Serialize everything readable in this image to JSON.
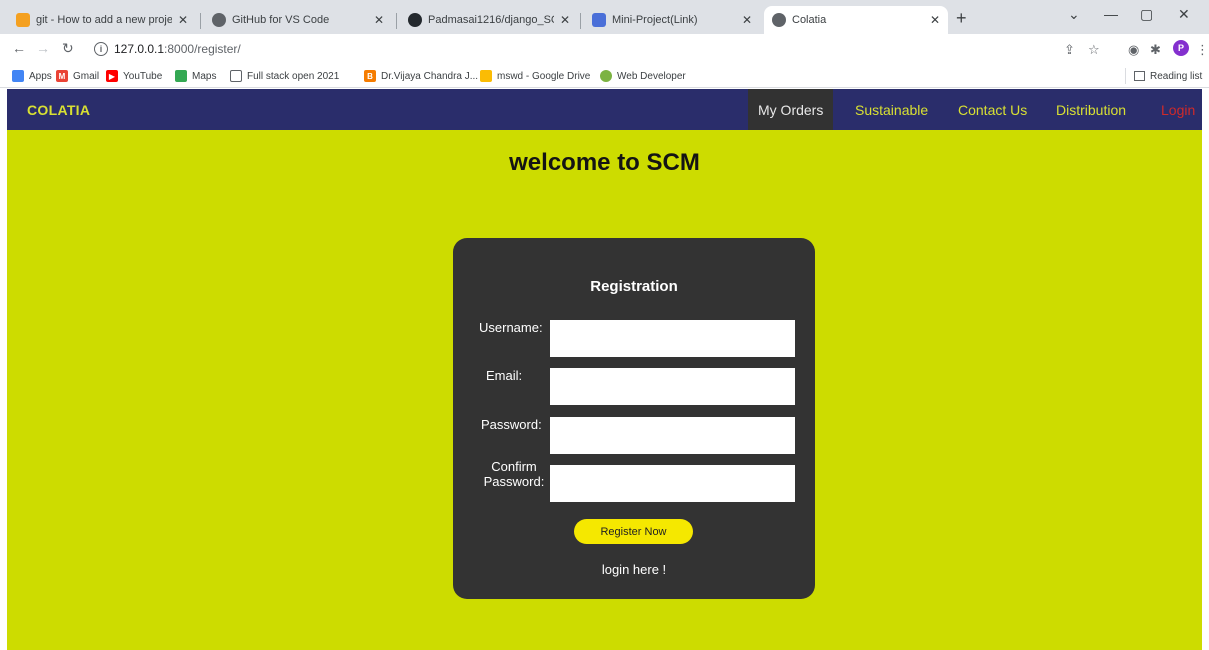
{
  "browser": {
    "tabs": [
      {
        "title": "git - How to add a new project to",
        "icon_color": "#f4a020",
        "active": false
      },
      {
        "title": "GitHub for VS Code",
        "icon_color": "#5f6368",
        "active": false
      },
      {
        "title": "Padmasai1216/django_SCM",
        "icon_color": "#24292e",
        "active": false
      },
      {
        "title": "Mini-Project(Link)",
        "icon_color": "#4a6fd8",
        "active": false
      },
      {
        "title": "Colatia",
        "icon_color": "#5f6368",
        "active": true
      }
    ],
    "url_host": "127.0.0.1",
    "url_path": ":8000/register/",
    "profile_initial": "P",
    "bookmarks": [
      {
        "label": "Apps",
        "icon_color": "#4285f4"
      },
      {
        "label": "Gmail",
        "icon_color": "#ea4335"
      },
      {
        "label": "YouTube",
        "icon_color": "#ff0000"
      },
      {
        "label": "Maps",
        "icon_color": "#34a853"
      },
      {
        "label": "Full stack open 2021",
        "icon_color": "#5f6368"
      },
      {
        "label": "Dr.Vijaya Chandra J...",
        "icon_color": "#f57c00"
      },
      {
        "label": "mswd - Google Drive",
        "icon_color": "#fbbc04"
      },
      {
        "label": "Web Developer",
        "icon_color": "#7cb342"
      }
    ],
    "reading_list": "Reading list"
  },
  "site": {
    "brand": "COLATIA",
    "nav": [
      {
        "label": "My Orders",
        "active": true
      },
      {
        "label": "Sustainable",
        "active": false
      },
      {
        "label": "Contact Us",
        "active": false
      },
      {
        "label": "Distribution",
        "active": false
      },
      {
        "label": "Login",
        "active": false
      }
    ],
    "heading": "welcome to SCM",
    "colors": {
      "background": "#cddc00",
      "navbar": "#2a2d6b",
      "card": "#333333",
      "button": "#f5e800",
      "login": "#cf2a2a"
    }
  },
  "form": {
    "title": "Registration",
    "username_label": "Username:",
    "email_label": "Email:",
    "password_label": "Password:",
    "confirm_label_1": "Confirm",
    "confirm_label_2": "Password:",
    "username_value": "",
    "email_value": "",
    "password_value": "",
    "confirm_value": "",
    "submit_label": "Register Now",
    "login_link": "login here !"
  }
}
